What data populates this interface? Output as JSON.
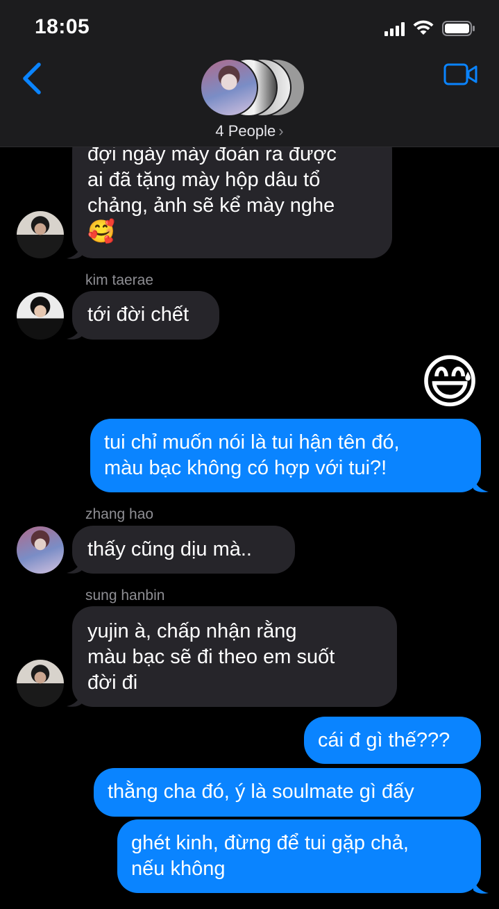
{
  "status": {
    "time": "18:05"
  },
  "header": {
    "people_label": "4 People",
    "chevron": "›"
  },
  "icons": {
    "back": "chevron-left-icon",
    "video": "video-camera-icon",
    "emoji_big": "grinning-sweat-emoji",
    "emoji_inline": "smiling-hearts-emoji"
  },
  "colors": {
    "accent": "#0a84ff",
    "incoming": "#26252a",
    "header_bg": "#1c1c1e"
  },
  "messages": [
    {
      "from": "sung hanbin",
      "side": "in",
      "lines": [
        "đợi ngày mày đoán ra được",
        "ai đã tặng mày hộp dâu tổ",
        "chảng, ảnh sẽ kể mày nghe"
      ],
      "emoji": "🥰"
    },
    {
      "from": "kim taerae",
      "sender_label": "kim taerae",
      "side": "in",
      "text": "tới đời chết"
    },
    {
      "side": "out",
      "big_emoji": "😅"
    },
    {
      "side": "out",
      "lines": [
        "tui chỉ muốn nói là tui hận tên đó,",
        "màu bạc không có hợp với tui?!"
      ]
    },
    {
      "from": "zhang hao",
      "sender_label": "zhang hao",
      "side": "in",
      "text": "thấy cũng dịu mà.."
    },
    {
      "from": "sung hanbin",
      "sender_label": "sung hanbin",
      "side": "in",
      "lines": [
        "yujin à, chấp nhận rằng",
        "màu bạc sẽ đi theo em suốt",
        "đời đi"
      ]
    },
    {
      "side": "out",
      "text": "cái đ gì thế???"
    },
    {
      "side": "out",
      "text": "thằng cha đó, ý là soulmate gì đấy"
    },
    {
      "side": "out",
      "lines": [
        "ghét kinh, đừng để tui gặp chả,",
        "nếu không"
      ]
    }
  ]
}
